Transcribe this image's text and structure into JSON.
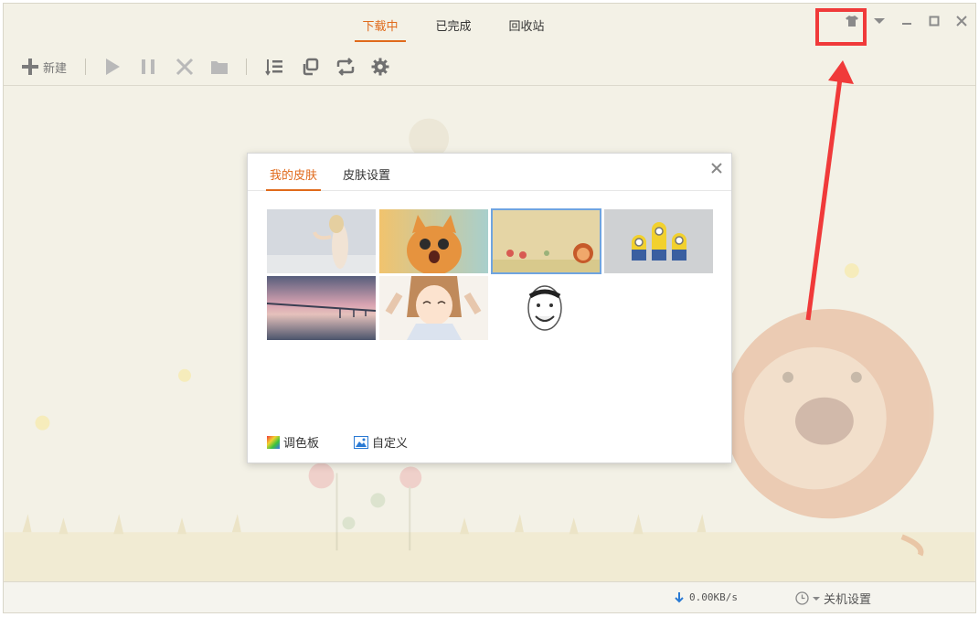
{
  "titlebar": {
    "tabs": [
      {
        "label": "下载中",
        "active": true
      },
      {
        "label": "已完成",
        "active": false
      },
      {
        "label": "回收站",
        "active": false
      }
    ],
    "window_buttons": [
      "skin-icon",
      "dropdown-icon",
      "minimize-icon",
      "maximize-icon",
      "close-icon"
    ]
  },
  "toolbar": {
    "new_label": "新建",
    "icons": [
      "plus-icon",
      "play-icon",
      "pause-icon",
      "delete-icon",
      "folder-icon",
      "list-sort-icon",
      "copy-window-icon",
      "refresh-icon",
      "gear-icon"
    ]
  },
  "dialog": {
    "tabs": [
      {
        "label": "我的皮肤",
        "active": true
      },
      {
        "label": "皮肤设置",
        "active": false
      }
    ],
    "skins": [
      "woman-skin",
      "kitten-skin",
      "lion-skin",
      "minions-skin",
      "bridge-skin",
      "anime-girl-skin",
      "meme-face-skin"
    ],
    "selected_skin": "lion-skin",
    "palette_label": "调色板",
    "custom_label": "自定义"
  },
  "status": {
    "speed": "0.00KB/s",
    "shutdown_label": "关机设置"
  },
  "colors": {
    "accent": "#e06a1b",
    "highlight_red": "#f03a3a",
    "background": "#f3f1e6",
    "selected_border": "#6fa4e0"
  }
}
